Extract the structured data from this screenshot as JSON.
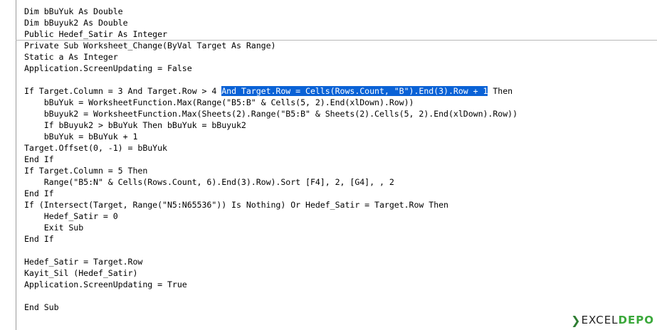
{
  "editor": {
    "declarations": [
      "Dim bBuYuk As Double",
      "Dim bBuyuk2 As Double",
      "Public Hedef_Satir As Integer"
    ],
    "proc": {
      "l01": "Private Sub Worksheet_Change(ByVal Target As Range)",
      "l02": "Static a As Integer",
      "l03": "Application.ScreenUpdating = False",
      "l04": "",
      "l05_pre": "If Target.Column = 3 And Target.Row > 4 ",
      "l05_sel": "And Target.Row = Cells(Rows.Count, \"B\").End(3).Row + 1",
      "l05_post": " Then",
      "l06": "    bBuYuk = WorksheetFunction.Max(Range(\"B5:B\" & Cells(5, 2).End(xlDown).Row))",
      "l07": "    bBuyuk2 = WorksheetFunction.Max(Sheets(2).Range(\"B5:B\" & Sheets(2).Cells(5, 2).End(xlDown).Row))",
      "l08": "    If bBuyuk2 > bBuYuk Then bBuYuk = bBuyuk2",
      "l09": "    bBuYuk = bBuYuk + 1",
      "l10": "Target.Offset(0, -1) = bBuYuk",
      "l11": "End If",
      "l12": "If Target.Column = 5 Then",
      "l13": "    Range(\"B5:N\" & Cells(Rows.Count, 6).End(3).Row).Sort [F4], 2, [G4], , 2",
      "l14": "End If",
      "l15": "If (Intersect(Target, Range(\"N5:N65536\")) Is Nothing) Or Hedef_Satir = Target.Row Then",
      "l16": "    Hedef_Satir = 0",
      "l17": "    Exit Sub",
      "l18": "End If",
      "l19": "",
      "l20": "Hedef_Satir = Target.Row",
      "l21": "Kayit_Sil (Hedef_Satir)",
      "l22": "Application.ScreenUpdating = True",
      "l23": "",
      "l24": "End Sub"
    }
  },
  "watermark": {
    "part1": "EXCEL",
    "part2": "DEPO",
    "chevron_icon": "chevron-right-icon"
  },
  "colors": {
    "selection": "#0a62d6",
    "watermark_green": "#3aa83a"
  }
}
